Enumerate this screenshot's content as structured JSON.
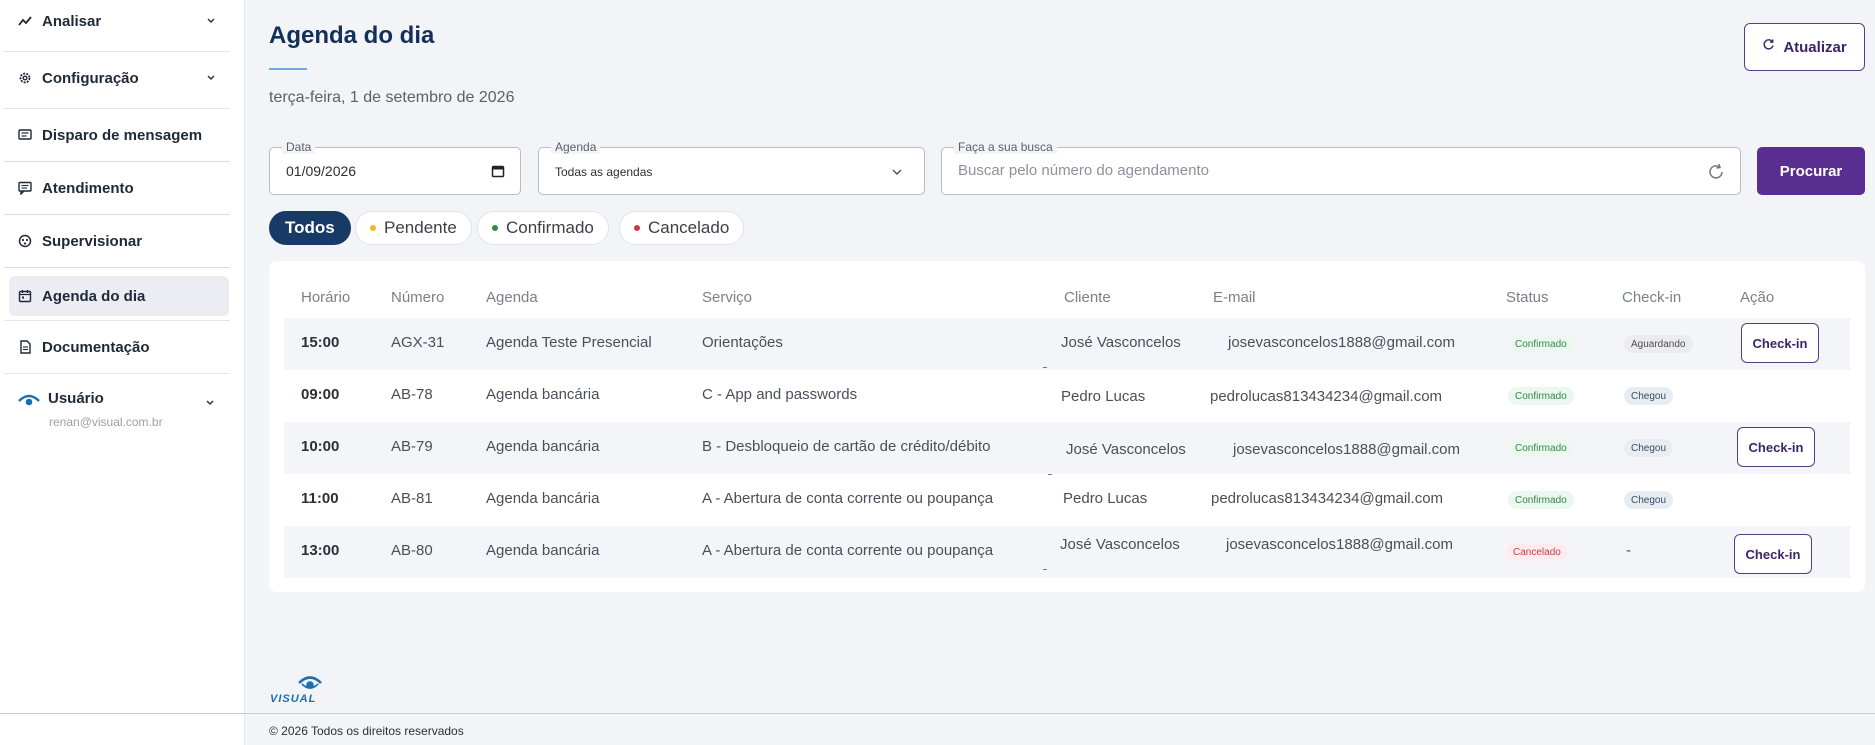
{
  "sidebar": {
    "items": [
      {
        "label": "Analisar",
        "icon": "chart-line-icon",
        "has_chevron": true
      },
      {
        "label": "Configuração",
        "icon": "gear-icon",
        "has_chevron": true
      },
      {
        "label": "Disparo de mensagem",
        "icon": "message-list-icon",
        "has_chevron": false
      },
      {
        "label": "Atendimento",
        "icon": "chat-icon",
        "has_chevron": false
      },
      {
        "label": "Supervisionar",
        "icon": "dashboard-icon",
        "has_chevron": false
      },
      {
        "label": "Agenda do dia",
        "icon": "calendar-icon",
        "has_chevron": false,
        "active": true
      },
      {
        "label": "Documentação",
        "icon": "document-icon",
        "has_chevron": false
      }
    ],
    "user": {
      "name": "Usuário",
      "email": "renan@visual.com.br"
    }
  },
  "header": {
    "title": "Agenda do dia",
    "subtitle": "terça-feira, 1 de setembro de 2026",
    "refresh_label": "Atualizar"
  },
  "filters": {
    "date": {
      "label": "Data",
      "value": "01/09/2026"
    },
    "agenda": {
      "label": "Agenda",
      "value": "Todas as agendas"
    },
    "search": {
      "label": "Faça a sua busca",
      "placeholder": "Buscar pelo número do agendamento"
    },
    "search_button": "Procurar"
  },
  "status_tabs": [
    {
      "label": "Todos",
      "active": true,
      "dot": null
    },
    {
      "label": "Pendente",
      "active": false,
      "dot": "#f2b824"
    },
    {
      "label": "Confirmado",
      "active": false,
      "dot": "#2f8a45"
    },
    {
      "label": "Cancelado",
      "active": false,
      "dot": "#d63341"
    }
  ],
  "table": {
    "headers": [
      "Horário",
      "Número",
      "Agenda",
      "Serviço",
      "Cliente",
      "E-mail",
      "Status",
      "Check-in",
      "Ação"
    ],
    "rows": [
      {
        "time": "15:00",
        "number": "AGX-31",
        "agenda": "Agenda Teste Presencial",
        "service": "Orientações",
        "client": "José Vasconcelos",
        "email": "josevasconcelos1888@gmail.com",
        "status": "Confirmado",
        "checkin": "Aguardando",
        "action": "Check-in"
      },
      {
        "time": "09:00",
        "number": "AB-78",
        "agenda": "Agenda bancária",
        "service": "C - App and passwords",
        "client": "Pedro Lucas",
        "email": "pedrolucas813434234@gmail.com",
        "status": "Confirmado",
        "checkin": "Chegou",
        "action": ""
      },
      {
        "time": "10:00",
        "number": "AB-79",
        "agenda": "Agenda bancária",
        "service": "B - Desbloqueio de cartão de crédito/débito",
        "client": "José Vasconcelos",
        "email": "josevasconcelos1888@gmail.com",
        "status": "Confirmado",
        "checkin": "Chegou",
        "action": "Check-in"
      },
      {
        "time": "11:00",
        "number": "AB-81",
        "agenda": "Agenda bancária",
        "service": "A - Abertura de conta corrente ou poupança",
        "client": "Pedro Lucas",
        "email": "pedrolucas813434234@gmail.com",
        "status": "Confirmado",
        "checkin": "Chegou",
        "action": ""
      },
      {
        "time": "13:00",
        "number": "AB-80",
        "agenda": "Agenda bancária",
        "service": "A - Abertura de conta corrente ou poupança",
        "client": "José Vasconcelos",
        "email": "josevasconcelos1888@gmail.com",
        "status": "Cancelado",
        "checkin": "-",
        "action": "Check-in"
      }
    ]
  },
  "brand": {
    "logo_text": "VISUAL",
    "color": "#1b6fb0"
  },
  "footer": {
    "text": "© 2026 Todos os direitos reservados"
  }
}
